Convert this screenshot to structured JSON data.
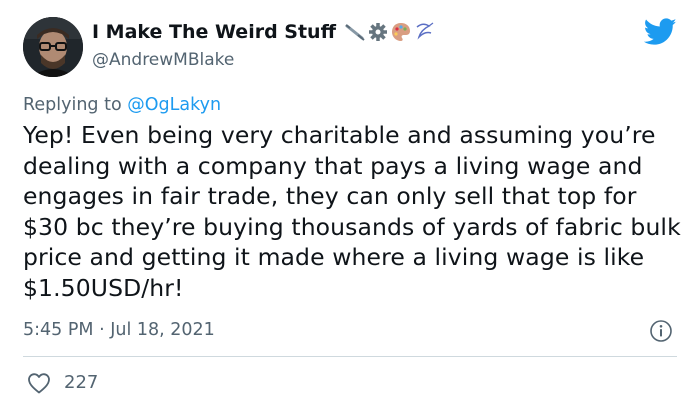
{
  "tweet": {
    "display_name": "I Make The Weird Stuff",
    "name_emojis": [
      "syringe-emoji",
      "gear-emoji",
      "palette-emoji",
      "thread-emoji"
    ],
    "handle": "@AndrewMBlake",
    "replying_prefix": "Replying to",
    "replying_to": "@OgLakyn",
    "text": "Yep! Even being very charitable and assuming you’re dealing with a company that pays a living wage and engages in fair trade, they can only sell that top for $30 bc they’re buying thousands of yards of fabric bulk price and getting it made where a living wage is like $1.50USD/hr!",
    "timestamp": "5:45 PM · Jul 18, 2021",
    "like_count": "227"
  },
  "colors": {
    "twitter_blue": "#1d9bf0",
    "text_primary": "#0f1419",
    "text_secondary": "#536471",
    "divider": "#cfd9de"
  },
  "icons": {
    "brand": "twitter-bird-icon",
    "info": "info-icon",
    "like": "heart-icon"
  }
}
